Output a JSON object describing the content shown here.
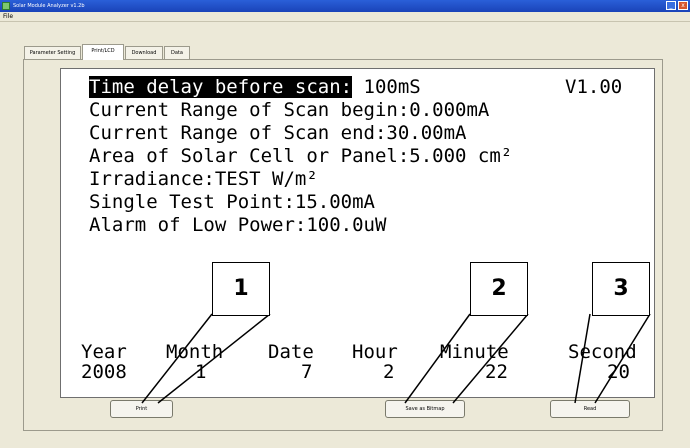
{
  "window": {
    "title": "Solar Module Analyzer v1.2b",
    "min_glyph": "_",
    "close_glyph": "x"
  },
  "menu": {
    "file_label": "File"
  },
  "tabs": [
    {
      "label": "Parameter Setting"
    },
    {
      "label": "Print/LCD"
    },
    {
      "label": "Download"
    },
    {
      "label": "Data"
    }
  ],
  "lcd": {
    "time_delay_label": "Time delay before scan:",
    "time_delay_value": " 100mS",
    "version": "V1.00",
    "line_range_begin": "Current Range of Scan begin:0.000mA",
    "line_range_end": "Current Range of Scan end:30.00mA",
    "line_area": "Area of Solar Cell or Panel:5.000 cm²",
    "line_irradiance": "Irradiance:TEST W/m²",
    "line_single_point": "Single Test Point:15.00mA",
    "line_alarm": "Alarm of Low Power:100.0uW"
  },
  "datetime": {
    "labels": [
      "Year",
      "Month",
      "Date",
      "Hour",
      "Minute",
      "Second"
    ],
    "values": [
      "2008",
      "1",
      "7",
      "2",
      "22",
      "20"
    ]
  },
  "buttons": {
    "print": "Print",
    "save_bitmap": "Save as Bitmap",
    "read": "Read"
  },
  "callouts": [
    "1",
    "2",
    "3"
  ]
}
